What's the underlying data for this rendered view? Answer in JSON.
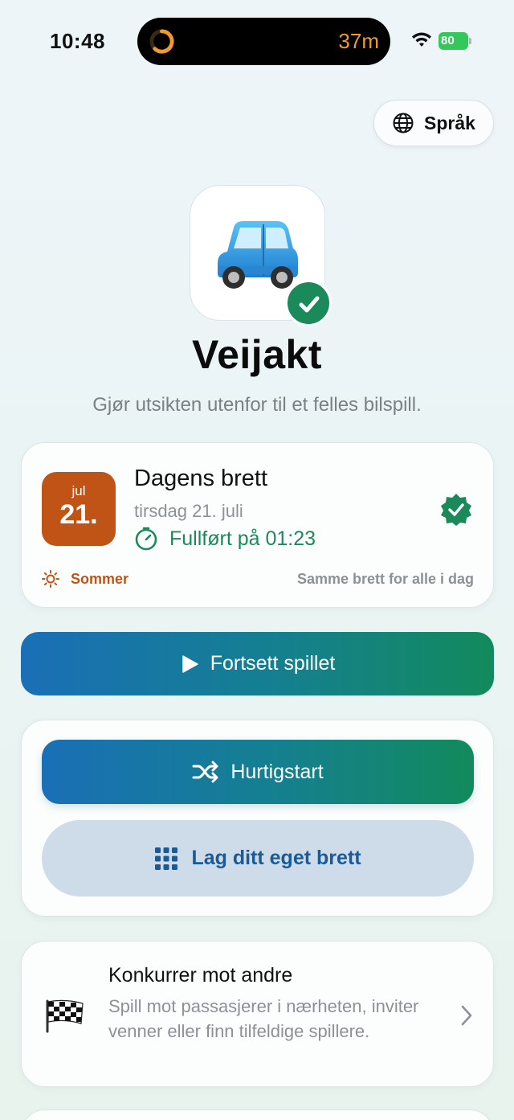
{
  "status_bar": {
    "time": "10:48",
    "timer": "37m",
    "battery": "80"
  },
  "language_button": {
    "label": "Språk",
    "icon": "globe-icon"
  },
  "app": {
    "title": "Veijakt",
    "subtitle": "Gjør utsikten utenfor til et felles bilspill.",
    "icon": "car-icon"
  },
  "daily": {
    "month": "jul",
    "day": "21.",
    "title": "Dagens brett",
    "date": "tirsdag 21. juli",
    "completed": "Fullført på 01:23",
    "season": "Sommer",
    "same_board": "Samme brett for alle i dag"
  },
  "buttons": {
    "continue": "Fortsett spillet",
    "quick_start": "Hurtigstart",
    "custom_board": "Lag ditt eget brett"
  },
  "compete": {
    "title": "Konkurrer mot andre",
    "description": "Spill mot passasjerer i nærheten, inviter venner eller finn tilfeldige spillere."
  },
  "colors": {
    "accent_green": "#1b8a5a",
    "accent_orange": "#bf5416",
    "gradient_start": "#1a6fb6",
    "gradient_end": "#138a5c",
    "custom_bg": "#cddce8"
  }
}
